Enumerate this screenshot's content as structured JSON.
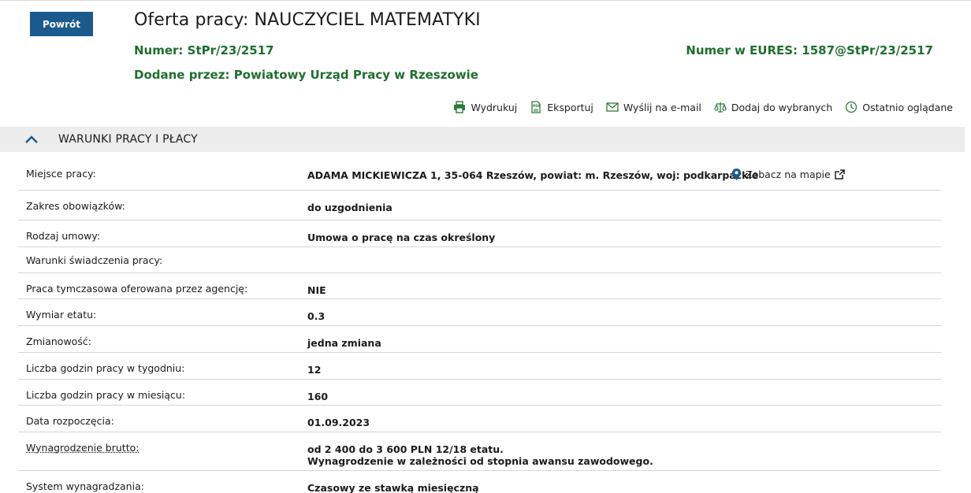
{
  "back_label": "Powrót",
  "title": "Oferta pracy: NAUCZYCIEL MATEMATYKI",
  "number_label": "Numer:",
  "number_value": "StPr/23/2517",
  "eures_label": "Numer w EURES:",
  "eures_value": "1587@StPr/23/2517",
  "added_label": "Dodane przez:",
  "added_value": "Powiatowy Urząd Pracy w Rzeszowie",
  "actions": {
    "print": "Wydrukuj",
    "export": "Eksportuj",
    "email": "Wyślij na e-mail",
    "favorite": "Dodaj do wybranych",
    "recent": "Ostatnio oglądane"
  },
  "section_title": "WARUNKI PRACY I PŁACY",
  "map_link": "Zobacz na mapie",
  "rows": [
    {
      "label": "Miejsce pracy:",
      "value": "ADAMA MICKIEWICZA 1, 35-064 Rzeszów, powiat: m. Rzeszów, woj: podkarpackie"
    },
    {
      "label": "Zakres obowiązków:",
      "value": "do uzgodnienia"
    },
    {
      "label": "Rodzaj umowy:",
      "value": "Umowa o pracę na czas określony"
    },
    {
      "label": "Warunki świadczenia pracy:",
      "value": ""
    },
    {
      "label": "Praca tymczasowa oferowana przez agencję:",
      "value": "NIE"
    },
    {
      "label": "Wymiar etatu:",
      "value": "0.3"
    },
    {
      "label": "Zmianowość:",
      "value": "jedna zmiana"
    },
    {
      "label": "Liczba godzin pracy w tygodniu:",
      "value": "12"
    },
    {
      "label": "Liczba godzin pracy w miesiącu:",
      "value": "160"
    },
    {
      "label": "Data rozpoczęcia:",
      "value": "01.09.2023"
    },
    {
      "label": "Wynagrodzenie brutto:",
      "value": "od 2 400 do 3 600 PLN 12/18 etatu.",
      "value2": "Wynagrodzenie w zależności od stopnia awansu zawodowego."
    },
    {
      "label": "System wynagradzania:",
      "value": "Czasowy ze stawką miesięczną"
    }
  ]
}
